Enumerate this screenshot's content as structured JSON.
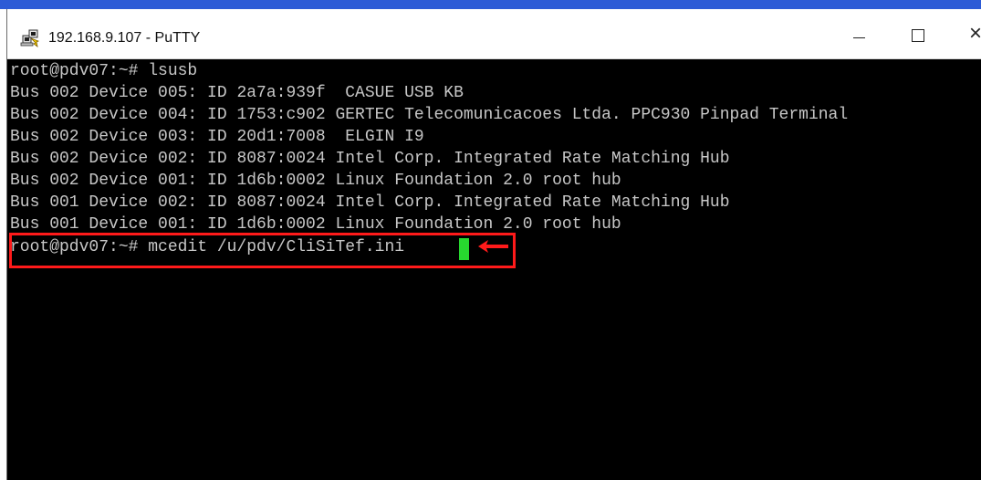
{
  "window": {
    "title": "192.168.9.107 - PuTTY",
    "icon": "putty-icon",
    "controls": {
      "minimize_icon": "minimize-icon",
      "maximize_icon": "maximize-icon",
      "close_icon": "close-icon",
      "close_symbol": "×"
    }
  },
  "terminal": {
    "lines": [
      "root@pdv07:~# lsusb",
      "Bus 002 Device 005: ID 2a7a:939f  CASUE USB KB",
      "Bus 002 Device 004: ID 1753:c902 GERTEC Telecomunicacoes Ltda. PPC930 Pinpad Terminal",
      "Bus 002 Device 003: ID 20d1:7008  ELGIN I9",
      "Bus 002 Device 002: ID 8087:0024 Intel Corp. Integrated Rate Matching Hub",
      "Bus 002 Device 001: ID 1d6b:0002 Linux Foundation 2.0 root hub",
      "Bus 001 Device 002: ID 8087:0024 Intel Corp. Integrated Rate Matching Hub",
      "Bus 001 Device 001: ID 1d6b:0002 Linux Foundation 2.0 root hub",
      "root@pdv07:~# mcedit /u/pdv/CliSiTef.ini"
    ],
    "cursor_color": "#27d82f",
    "highlight_color": "#ff1a1a",
    "arrow_icon": "left-arrow-icon"
  },
  "colors": {
    "accent": "#2d5bd6",
    "terminal_background": "#000000",
    "terminal_text": "#c7c7c7"
  }
}
